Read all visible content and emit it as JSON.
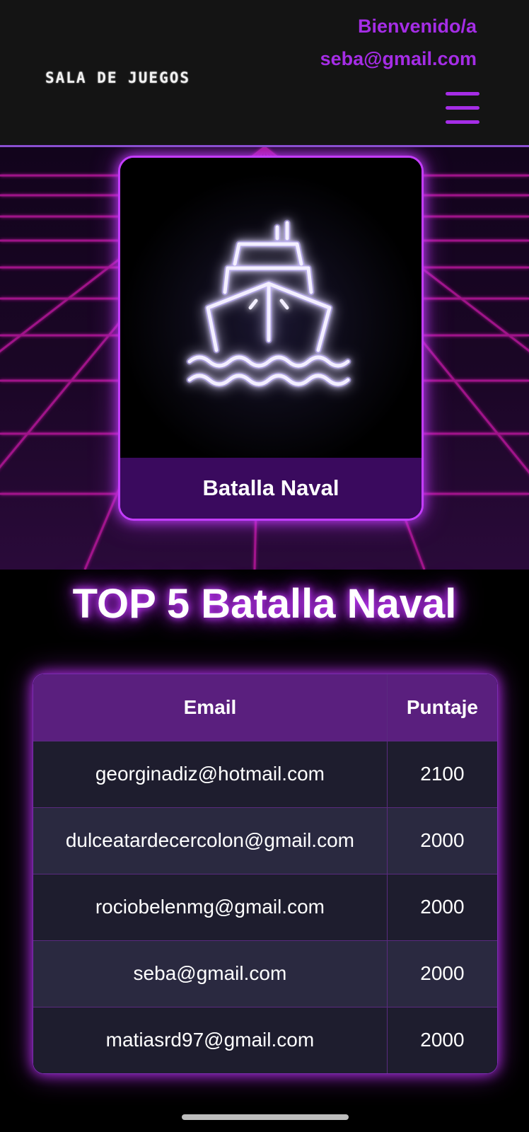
{
  "header": {
    "brand": "SALA DE JUEGOS",
    "welcome": "Bienvenido/a",
    "user_email": "seba@gmail.com",
    "menu_icon": "hamburger-menu-icon"
  },
  "game_card": {
    "icon": "ship-icon",
    "label": "Batalla Naval"
  },
  "leaderboard": {
    "title": "TOP 5 Batalla Naval",
    "columns": [
      "Email",
      "Puntaje"
    ],
    "rows": [
      {
        "email": "georginadiz@hotmail.com",
        "score": "2100"
      },
      {
        "email": "dulceatardecercolon@gmail.com",
        "score": "2000"
      },
      {
        "email": "rociobelenmg@gmail.com",
        "score": "2000"
      },
      {
        "email": "seba@gmail.com",
        "score": "2000"
      },
      {
        "email": "matiasrd97@gmail.com",
        "score": "2000"
      }
    ]
  },
  "colors": {
    "accent": "#a52de6",
    "neon": "#c43cff",
    "header_bg": "#141414",
    "table_header": "#5a1f7e"
  }
}
